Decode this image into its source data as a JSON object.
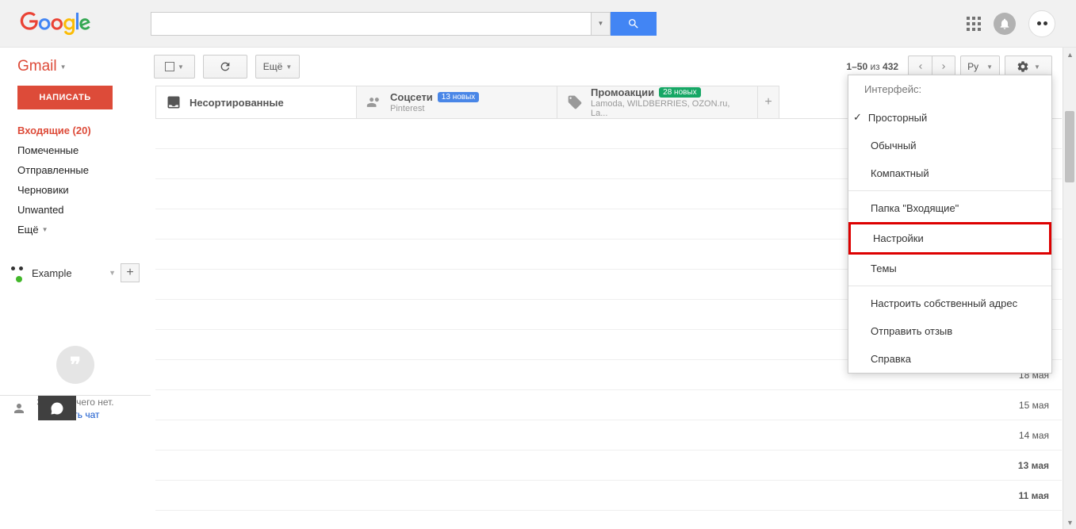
{
  "header": {
    "logo_colors": [
      "#4285F4",
      "#EA4335",
      "#FBBC05",
      "#4285F4",
      "#34A853",
      "#EA4335"
    ]
  },
  "gmail_label": "Gmail",
  "compose": "НАПИСАТЬ",
  "sidebar": {
    "items": [
      {
        "label": "Входящие (20)",
        "active": true
      },
      {
        "label": "Помеченные"
      },
      {
        "label": "Отправленные"
      },
      {
        "label": "Черновики"
      },
      {
        "label": "Unwanted"
      }
    ],
    "more": "Ещё"
  },
  "hangouts": {
    "user": "Example",
    "empty_text": "Здесь ничего нет.",
    "start_chat": "Начать чат"
  },
  "toolbar": {
    "more_label": "Ещё",
    "page_info_range": "1–50",
    "page_info_of": "из",
    "page_info_total": "432",
    "lang": "Ру"
  },
  "tabs": [
    {
      "title": "Несортированные"
    },
    {
      "title": "Соцсети",
      "badge": "13 новых",
      "badge_color": "blue",
      "sub": "Pinterest"
    },
    {
      "title": "Промоакции",
      "badge": "28 новых",
      "badge_color": "green",
      "sub": "Lamoda, WILDBERRIES, OZON.ru, La..."
    }
  ],
  "settings_menu": {
    "heading": "Интерфейс:",
    "density": [
      "Просторный",
      "Обычный",
      "Компактный"
    ],
    "inbox_folder": "Папка \"Входящие\"",
    "settings": "Настройки",
    "themes": "Темы",
    "configure": "Настроить собственный адрес",
    "feedback": "Отправить отзыв",
    "help": "Справка"
  },
  "emails": [
    {
      "date": ""
    },
    {
      "date": ""
    },
    {
      "date": ""
    },
    {
      "date": ""
    },
    {
      "date": ""
    },
    {
      "date": ""
    },
    {
      "date": ""
    },
    {
      "date": ""
    },
    {
      "date": "18 мая"
    },
    {
      "date": "15 мая"
    },
    {
      "date": "14 мая"
    },
    {
      "date": "13 мая",
      "bold": true
    },
    {
      "date": "11 мая",
      "bold": true
    }
  ]
}
